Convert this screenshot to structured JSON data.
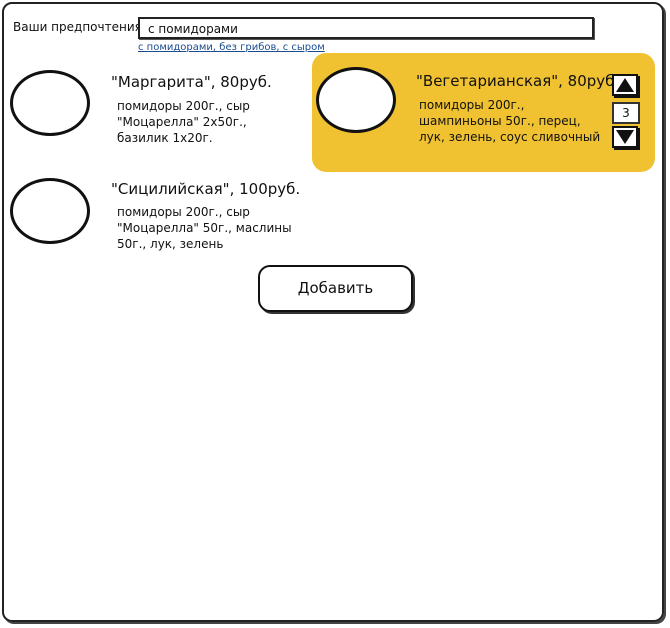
{
  "preferences": {
    "label": "Ваши предпочтения:",
    "value": "с помидорами",
    "suggestion": "с помидорами, без грибов, с сыром"
  },
  "pizzas": [
    {
      "title": "\"Маргарита\", 80руб.",
      "description": "помидоры 200г., сыр\n\"Моцарелла\" 2х50г.,\nбазилик 1х20г.",
      "selected": false
    },
    {
      "title": "\"Вегетарианская\", 80руб.",
      "description": "помидоры 200г.,\nшампиньоны 50г., перец,\nлук, зелень, соус сливочный",
      "selected": true,
      "quantity": "3",
      "accent_color": "#f0c232"
    },
    {
      "title": "\"Сицилийская\", 100руб.",
      "description": "помидоры 200г., сыр\n\"Моцарелла\" 50г., маслины\n50г., лук, зелень",
      "selected": false
    }
  ],
  "add_button": {
    "label": "Добавить"
  },
  "icons": {
    "increment": "triangle-up-icon",
    "decrement": "triangle-down-icon"
  }
}
